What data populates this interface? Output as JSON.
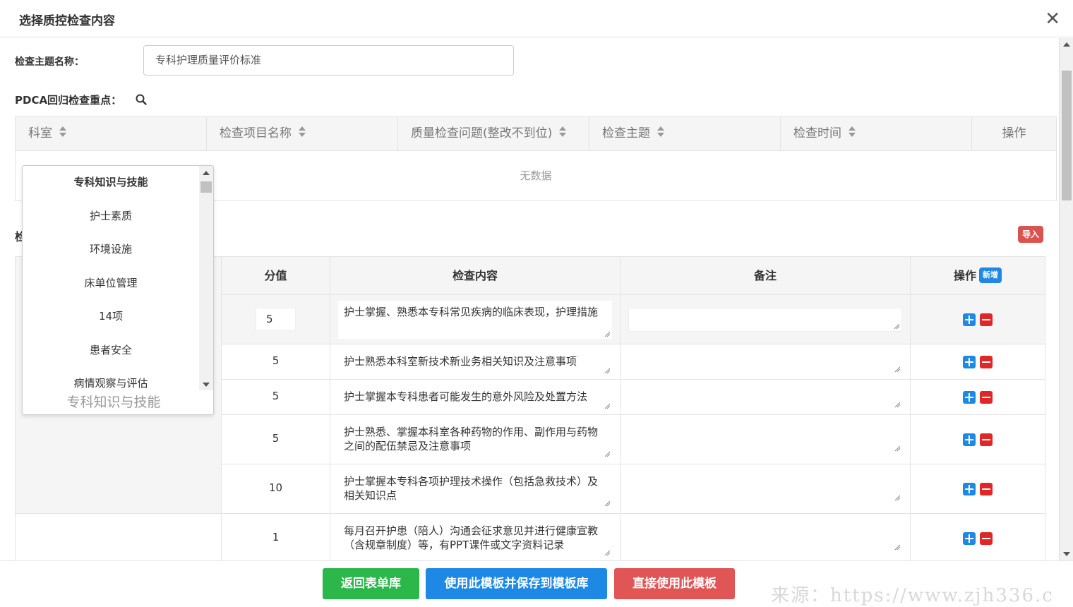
{
  "modal": {
    "title": "选择质控检查内容",
    "close_glyph": "✕"
  },
  "form": {
    "theme_label": "检查主题名称：",
    "theme_value": "专科护理质量评价标准",
    "pdca_label": "PDCA回归检查重点："
  },
  "pdca_table": {
    "columns": [
      "科室",
      "检查项目名称",
      "质量检查问题(整改不到位)",
      "检查主题",
      "检查时间",
      "操作"
    ],
    "empty_text": "无数据"
  },
  "section": {
    "partial_label": "检",
    "import_label": "导入"
  },
  "main_table": {
    "columns": [
      "分值",
      "检查内容",
      "备注",
      "操作"
    ],
    "new_badge": "新增",
    "rows": [
      {
        "score": "5",
        "content": "护士掌握、熟悉本专科常见疾病的临床表现，护理措施"
      },
      {
        "score": "5",
        "content": "护士熟悉本科室新技术新业务相关知识及注意事项"
      },
      {
        "score": "5",
        "content": "护士掌握本专科患者可能发生的意外风险及处置方法"
      },
      {
        "score": "5",
        "content": "护士熟悉、掌握本科室各种药物的作用、副作用与药物之间的配伍禁忌及注意事项"
      },
      {
        "score": "10",
        "content": "护士掌握本专科各项护理技术操作（包括急救技术）及相关知识点"
      },
      {
        "score": "1",
        "content": "每月召开护患（陪人）沟通会征求意见并进行健康宣教（含规章制度）等，有PPT课件或文字资料记录"
      }
    ]
  },
  "dropdown": {
    "options": [
      "专科知识与技能",
      "护士素质",
      "环境设施",
      "床单位管理",
      "14项",
      "患者安全",
      "病情观察与评估"
    ],
    "selected_value": "专科知识与技能"
  },
  "footer": {
    "back_label": "返回表单库",
    "save_template_label": "使用此模板并保存到模板库",
    "use_template_label": "直接使用此模板"
  },
  "watermark": "来源：https://www.zjh336.c",
  "colors": {
    "green": "#2bb74a",
    "blue": "#1e88e5",
    "red": "#e05555",
    "badge_red": "#d9534f"
  }
}
